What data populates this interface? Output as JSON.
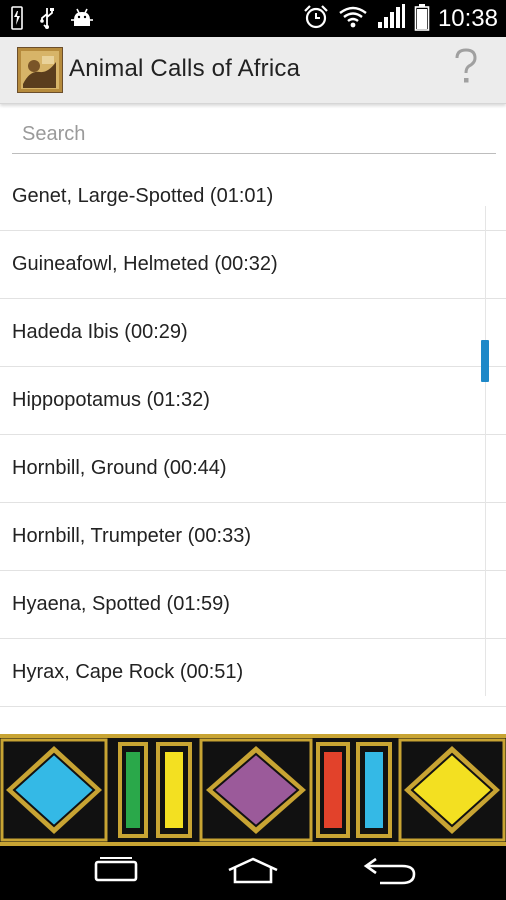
{
  "status_bar": {
    "time": "10:38",
    "icons": [
      "usb-icon",
      "usb-debug-icon",
      "android-debug-icon",
      "alarm-icon",
      "wifi-icon",
      "signal-icon",
      "battery-icon"
    ]
  },
  "app_bar": {
    "title": "Animal Calls of Africa",
    "help_icon": "help-icon"
  },
  "search": {
    "placeholder": "Search",
    "value": ""
  },
  "animals": [
    {
      "label": "Genet, Large-Spotted (01:01)"
    },
    {
      "label": "Guineafowl, Helmeted (00:32)"
    },
    {
      "label": "Hadeda Ibis (00:29)"
    },
    {
      "label": "Hippopotamus (01:32)"
    },
    {
      "label": "Hornbill, Ground (00:44)"
    },
    {
      "label": "Hornbill, Trumpeter (00:33)"
    },
    {
      "label": "Hyaena, Spotted (01:59)"
    },
    {
      "label": "Hyrax, Cape Rock (00:51)"
    }
  ],
  "scroll": {
    "position_fraction": 0.3
  },
  "colors": {
    "accent": "#1e88c8",
    "banner_gold": "#c8a433",
    "banner_black": "#111111",
    "diamond_blue": "#34b9e6",
    "diamond_purple": "#9b5a9a",
    "diamond_yellow": "#f3e021",
    "bar_green": "#2aa84a",
    "bar_yellow": "#f3e021",
    "bar_red": "#e2422b",
    "bar_blue": "#34b9e6"
  },
  "nav_bar": {
    "icons": [
      "recent-apps-icon",
      "home-icon",
      "back-icon"
    ]
  }
}
